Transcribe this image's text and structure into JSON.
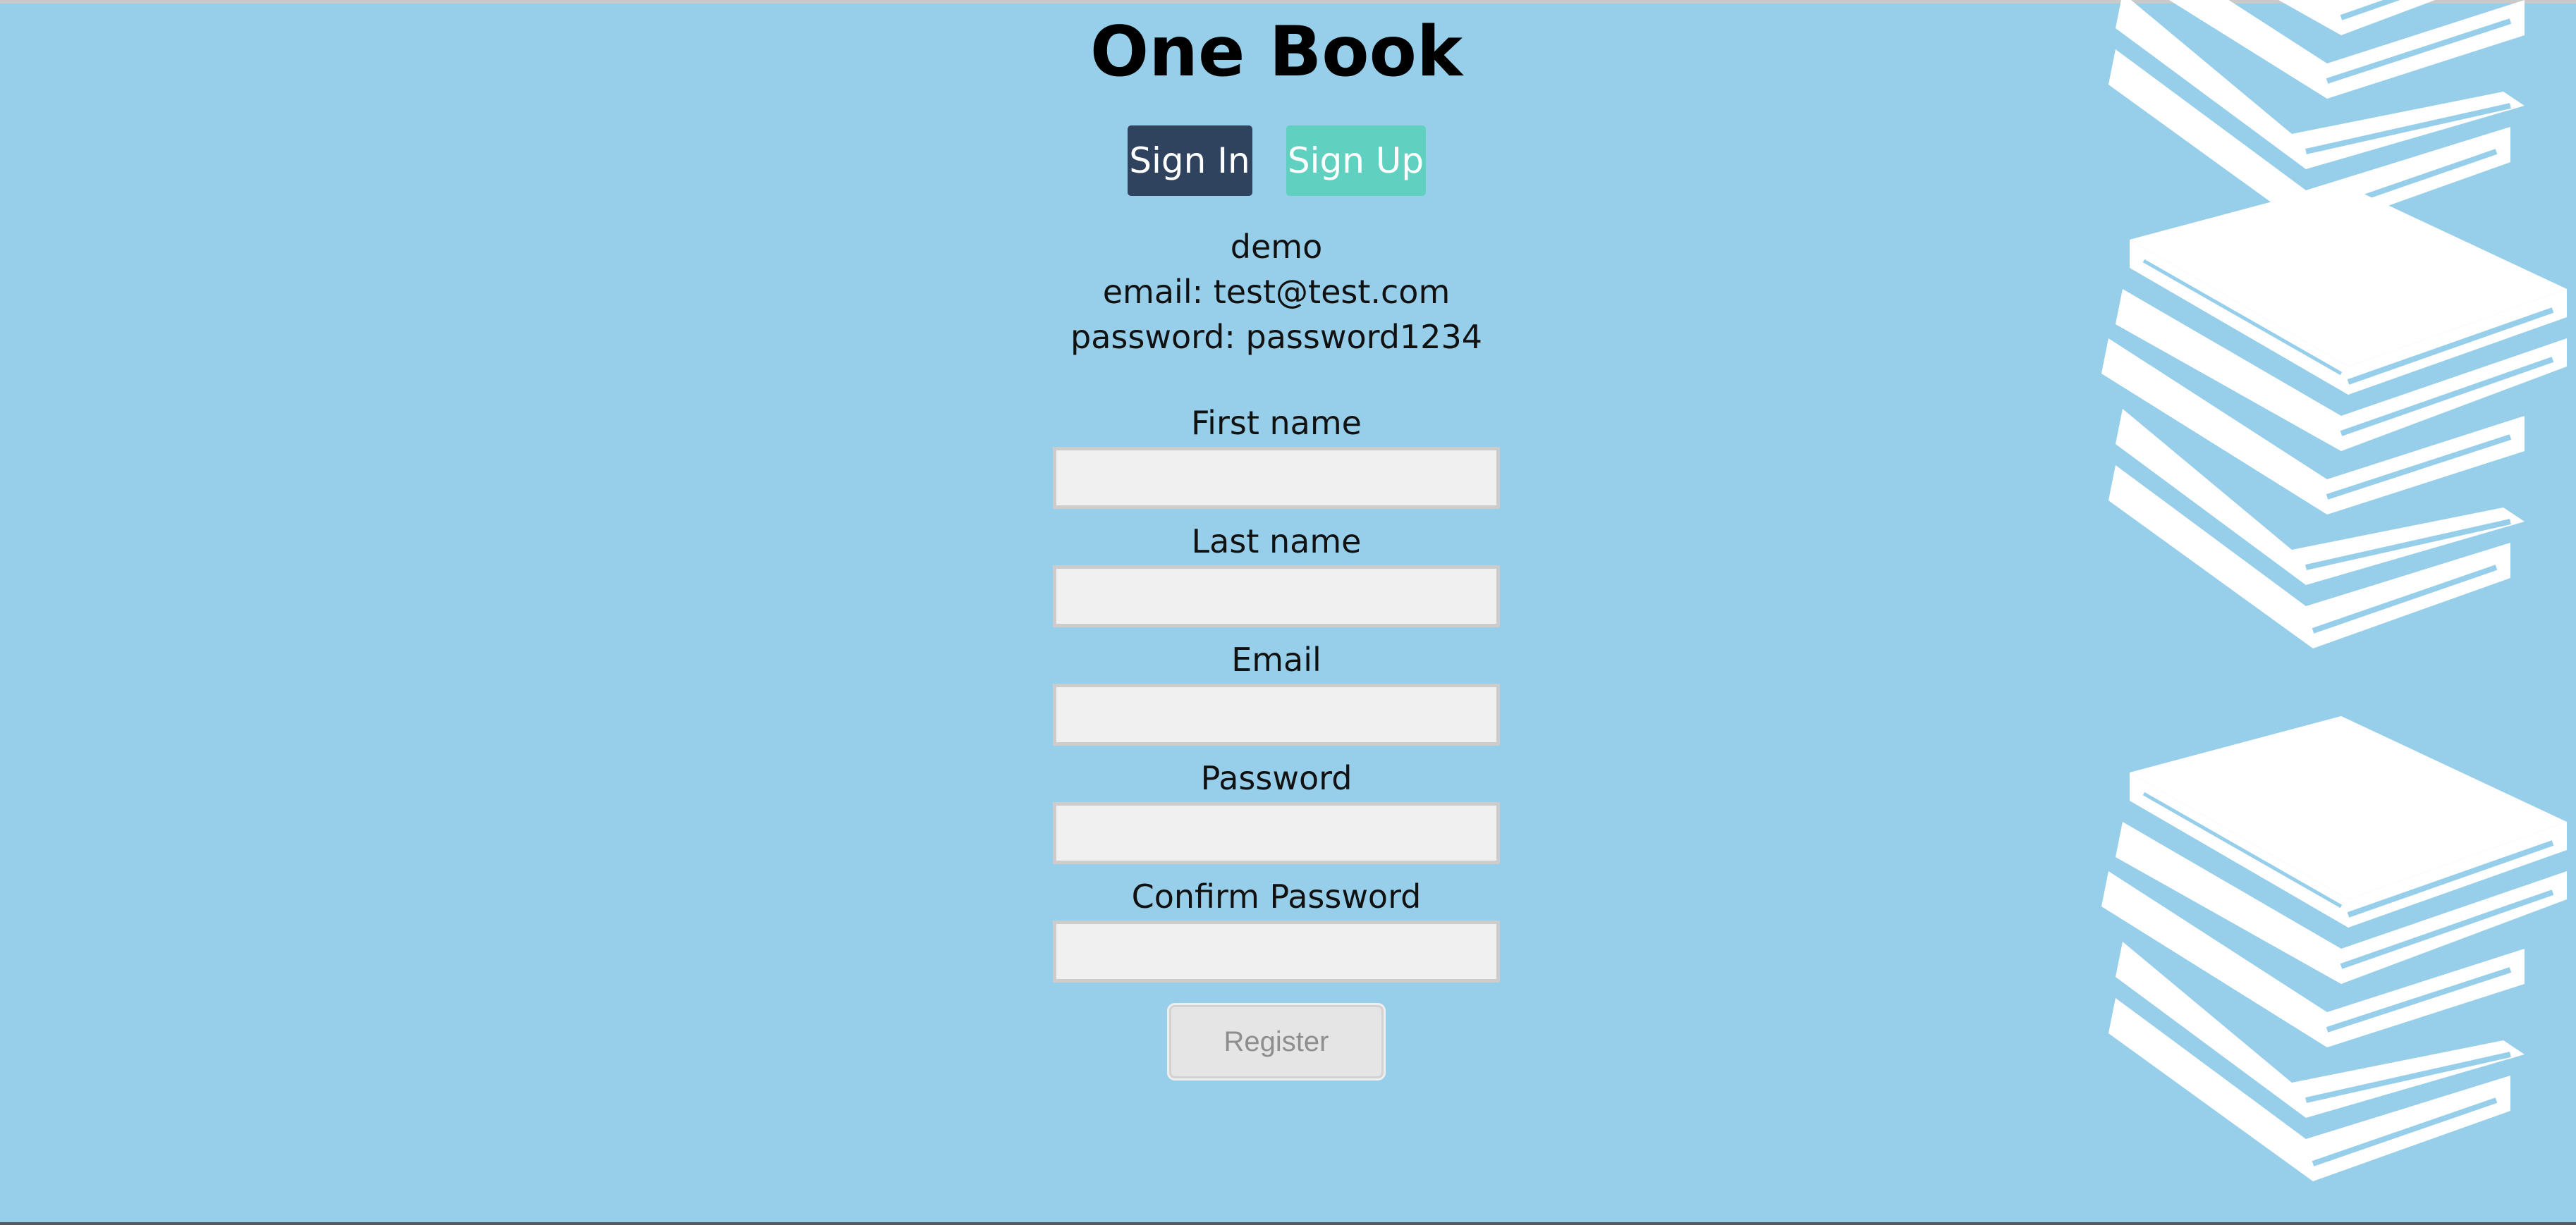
{
  "app": {
    "title": "One Book"
  },
  "nav": {
    "sign_in_label": "Sign In",
    "sign_up_label": "Sign Up"
  },
  "demo": {
    "heading": "demo",
    "email_line": "email: test@test.com",
    "password_line": "password: password1234"
  },
  "form": {
    "first_name_label": "First name",
    "first_name_value": "",
    "last_name_label": "Last name",
    "last_name_value": "",
    "email_label": "Email",
    "email_value": "",
    "password_label": "Password",
    "password_value": "",
    "confirm_password_label": "Confirm Password",
    "confirm_password_value": "",
    "register_label": "Register"
  },
  "colors": {
    "background": "#97cfea",
    "sign_in_button": "#2f425e",
    "sign_up_button": "#60d1c0",
    "input_background": "#f0f0f0",
    "register_button": "#e5e5e5"
  },
  "decoration": {
    "icon": "stacked-books-icon"
  }
}
